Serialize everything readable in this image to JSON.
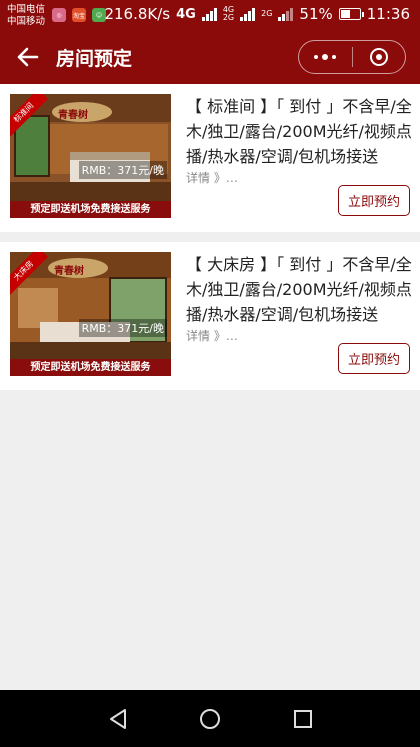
{
  "status_bar": {
    "carrier_1": "中国电信",
    "carrier_2": "中国移动",
    "app_badge": "淘宝",
    "speed": "216.8K/s",
    "net_1": "4G",
    "net_2": "4G",
    "net_3": "2G",
    "net_4": "2G",
    "battery": "51%",
    "time": "11:36"
  },
  "nav": {
    "title": "房间预定"
  },
  "rooms": [
    {
      "tag": "标准间",
      "title": "【 标准间 】「 到付 」不含早/全木/独卫/露台/200M光纤/视频点播/热水器/空调/包机场接送",
      "price": "RMB：371元/晚",
      "promo": "预定即送机场免费接送服务",
      "details": "详情 》…",
      "button": "立即预约",
      "logo_text": "青春树"
    },
    {
      "tag": "大床房",
      "title": "【 大床房 】「 到付 」不含早/全木/独卫/露台/200M光纤/视频点播/热水器/空调/包机场接送",
      "price": "RMB：371元/晚",
      "promo": "预定即送机场免费接送服务",
      "details": "详情 》…",
      "button": "立即预约",
      "logo_text": "青春树"
    }
  ],
  "colors": {
    "brand": "#8b0a0a",
    "background": "#efefef"
  }
}
